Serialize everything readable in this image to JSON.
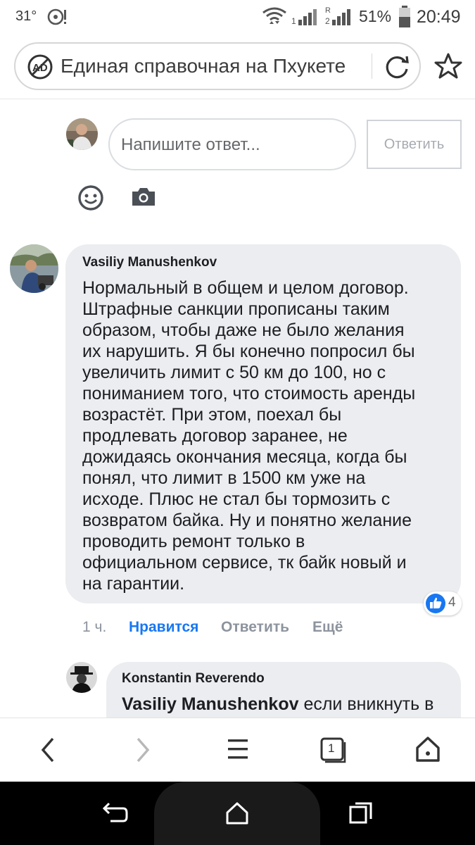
{
  "status_bar": {
    "temperature": "31°",
    "battery_percent": "51%",
    "time": "20:49",
    "wifi_icon": "wifi-icon",
    "signal_icon": "signal-icon",
    "battery_icon": "battery-icon"
  },
  "browser": {
    "page_title": "Единая справочная на Пхукете",
    "adblock_icon": "adblock-icon",
    "reload_icon": "reload-icon",
    "bookmark_icon": "star-icon",
    "tab_count": "1"
  },
  "composer": {
    "placeholder": "Напишите ответ...",
    "reply_button": "Ответить",
    "emoji_icon": "emoji-icon",
    "camera_icon": "camera-icon"
  },
  "comment": {
    "author": "Vasiliy Manushenkov",
    "lines": [
      "Нормальный в общем и целом договор.",
      "Штрафные санкции прописаны таким",
      "образом, чтобы даже не было желания",
      "их нарушить. Я бы конечно попросил бы",
      "увеличить лимит с 50 км до 100, но с",
      "пониманием того, что стоимость аренды",
      "возрастёт. При этом, поехал бы",
      "продлевать договор заранее, не",
      "дожидаясь окончания месяца, когда бы",
      "понял, что лимит в 1500 км уже на",
      "исходе. Плюс не стал бы тормозить с",
      "возвратом байка. Ну и понятно желание",
      "проводить ремонт только в",
      "официальном сервисе, тк байк новый и",
      "на гарантии."
    ],
    "likes": "4",
    "time": "1 ч.",
    "like_action": "Нравится",
    "reply_action": "Ответить",
    "more_action": "Ещё"
  },
  "reply_comment": {
    "author": "Konstantin Reverendo",
    "mention": "Vasiliy Manushenkov",
    "text": " если вникнуть в"
  },
  "colors": {
    "facebook_blue": "#1877f2",
    "bubble_gray": "#ebedf0"
  }
}
